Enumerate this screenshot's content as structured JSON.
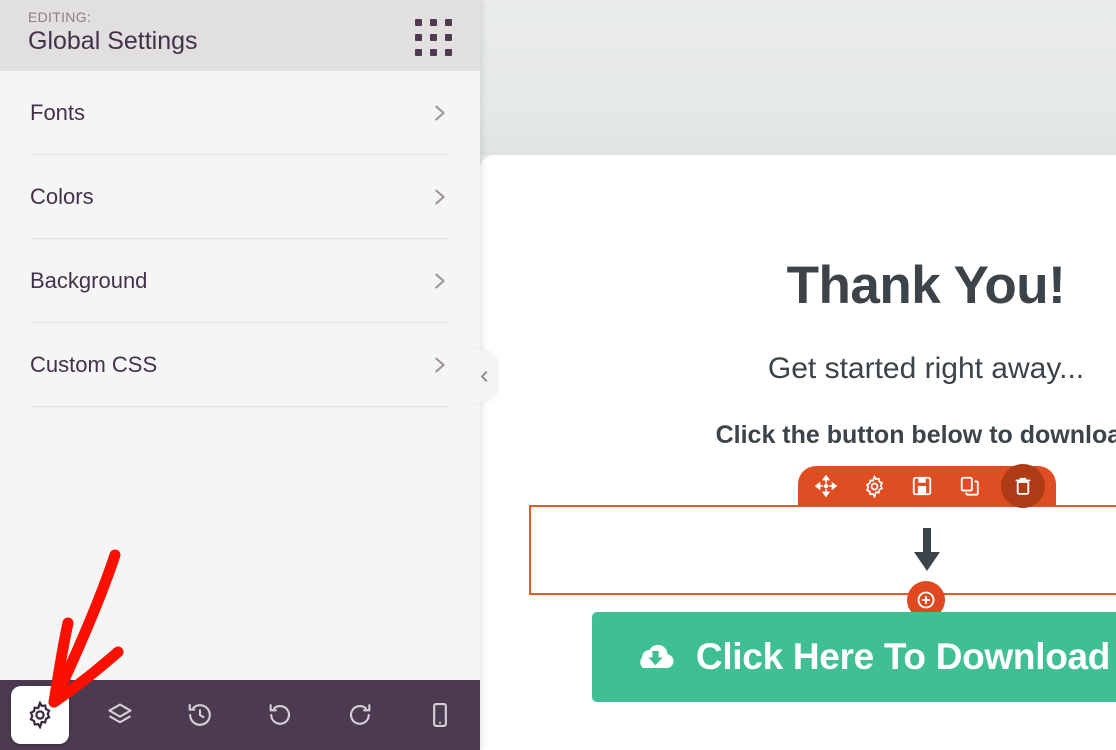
{
  "panel": {
    "header": {
      "editing_label": "EDITING:",
      "title": "Global Settings",
      "drag_handle_icon": "dot-grid-icon"
    },
    "items": [
      {
        "label": "Fonts",
        "chevron_icon": "chevron-right-icon"
      },
      {
        "label": "Colors",
        "chevron_icon": "chevron-right-icon"
      },
      {
        "label": "Background",
        "chevron_icon": "chevron-right-icon"
      },
      {
        "label": "Custom CSS",
        "chevron_icon": "chevron-right-icon"
      }
    ],
    "bottom_toolbar": [
      {
        "icon": "gear-icon",
        "name": "settings",
        "active": true
      },
      {
        "icon": "layers-icon",
        "name": "layers",
        "active": false
      },
      {
        "icon": "history-icon",
        "name": "revisions",
        "active": false
      },
      {
        "icon": "undo-icon",
        "name": "undo",
        "active": false
      },
      {
        "icon": "redo-icon",
        "name": "redo",
        "active": false
      },
      {
        "icon": "mobile-icon",
        "name": "mobile-preview",
        "active": false
      }
    ],
    "collapse_tab_icon": "chevron-left-icon"
  },
  "canvas": {
    "headline": "Thank You!",
    "subhead": "Get started right away...",
    "cta_line": "Click the button below to download",
    "download_button": {
      "label": "Click Here To Download",
      "icon": "cloud-download-icon"
    },
    "element_toolbar": [
      {
        "icon": "move-icon",
        "name": "move",
        "active": false
      },
      {
        "icon": "gear-icon",
        "name": "element-settings",
        "active": false
      },
      {
        "icon": "save-icon",
        "name": "save",
        "active": false
      },
      {
        "icon": "duplicate-icon",
        "name": "duplicate",
        "active": false
      },
      {
        "icon": "trash-icon",
        "name": "delete",
        "active": true
      }
    ],
    "add_button_icon": "plus-circle-icon",
    "placeholder_arrow_icon": "arrow-down-icon"
  },
  "colors": {
    "panel_bg": "#f5f5f5",
    "panel_header_bg": "#e2dfe1",
    "purple_text": "#43324a",
    "bottom_bar": "#4c3a50",
    "canvas_bg": "#e7ebe8",
    "accent_orange": "#df4d22",
    "outline_orange": "#e8562a",
    "trash_highlight": "#ae3a16",
    "green_button": "#40bf94",
    "annotation_red": "#fa0f00",
    "heading_text": "#3c4449"
  }
}
